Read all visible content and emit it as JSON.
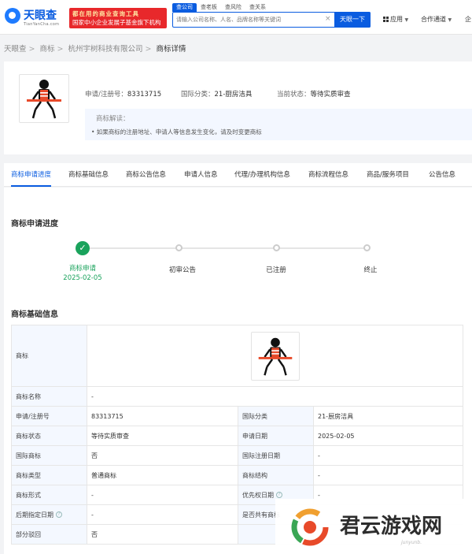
{
  "header": {
    "logo_text": "天眼查",
    "logo_sub": "TianYanCha.com",
    "promo_line1": "都在用的商业查询工具",
    "promo_line2": "国家中小企业发展子基金旗下机构",
    "search_tabs": [
      "查公司",
      "查老板",
      "查风险",
      "查关系"
    ],
    "search_placeholder": "请输入公司名称、人名、品牌名称等关键词",
    "search_button": "天眼一下",
    "nav_app": "应用",
    "nav_partner": "合作通道",
    "nav_enterprise": "企"
  },
  "breadcrumb": [
    "天眼查",
    "商标",
    "杭州宇树科技有限公司",
    "商标详情"
  ],
  "summary": {
    "reg_no_label": "申请/注册号：",
    "reg_no": "83313715",
    "class_label": "国际分类：",
    "class_value": "21-厨房洁具",
    "status_label": "当前状态：",
    "status_value": "等待实质审查",
    "notice_title": "商标解读：",
    "notice_text": "• 如果商标的注册地址、申请人等信息发生变化，请及时变更商标"
  },
  "tabs": [
    "商标申请进度",
    "商标基础信息",
    "商标公告信息",
    "申请人信息",
    "代理/办理机构信息",
    "商标流程信息",
    "商品/服务项目",
    "公告信息"
  ],
  "progress": {
    "title": "商标申请进度",
    "steps": [
      {
        "label": "商标申请",
        "date": "2025-02-05",
        "done": true
      },
      {
        "label": "初审公告",
        "date": "",
        "done": false
      },
      {
        "label": "已注册",
        "date": "",
        "done": false
      },
      {
        "label": "终止",
        "date": "",
        "done": false
      }
    ]
  },
  "basic": {
    "title": "商标基础信息",
    "tm_label": "商标",
    "name_label": "商标名称",
    "name_value": "-",
    "rows": [
      {
        "l1": "申请/注册号",
        "v1": "83313715",
        "l2": "国际分类",
        "v2": "21-厨房洁具"
      },
      {
        "l1": "商标状态",
        "v1": "等待实质审查",
        "l2": "申请日期",
        "v2": "2025-02-05"
      },
      {
        "l1": "国际商标",
        "v1": "否",
        "l2": "国际注册日期",
        "v2": "-"
      },
      {
        "l1": "商标类型",
        "v1": "普通商标",
        "l2": "商标结构",
        "v2": "-"
      },
      {
        "l1": "商标形式",
        "v1": "-",
        "l2": "优先权日期",
        "v2": "-"
      },
      {
        "l1": "后期指定日期",
        "v1": "-",
        "l2": "是否共有商标",
        "v2": "-"
      },
      {
        "l1": "部分驳回",
        "v1": "否",
        "l2": "",
        "v2": ""
      }
    ]
  },
  "watermark": {
    "text": "君云游戏网",
    "sub": "junyunb."
  },
  "colors": {
    "primary": "#0a5ce0",
    "success": "#1aa35c",
    "promo_red": "#e8282b",
    "vest_red": "#e84a2a"
  }
}
